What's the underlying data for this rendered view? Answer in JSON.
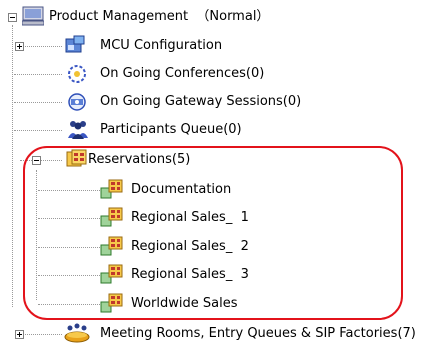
{
  "tree": {
    "root": {
      "label": "Product Management  （Normal）",
      "expanded": true
    },
    "children": [
      {
        "id": "mcu",
        "label": "MCU Configuration",
        "expanded": false,
        "icon": "mcu-config-icon"
      },
      {
        "id": "conf",
        "label": "On Going Conferences(0)",
        "icon": "conference-icon"
      },
      {
        "id": "gw",
        "label": "On Going Gateway Sessions(0)",
        "icon": "gateway-icon"
      },
      {
        "id": "pq",
        "label": "Participants Queue(0)",
        "icon": "participants-icon"
      },
      {
        "id": "res",
        "label": "Reservations(5)",
        "expanded": true,
        "icon": "reservations-icon",
        "children": [
          {
            "label": "Documentation"
          },
          {
            "label": "Regional Sales_  1"
          },
          {
            "label": "Regional Sales_  2"
          },
          {
            "label": "Regional Sales_  3"
          },
          {
            "label": "Worldwide Sales"
          }
        ]
      },
      {
        "id": "mr",
        "label": "Meeting Rooms, Entry Queues & SIP Factories(7)",
        "expanded": false,
        "icon": "meeting-rooms-icon"
      }
    ]
  },
  "highlight": {
    "color": "#e3131b"
  }
}
